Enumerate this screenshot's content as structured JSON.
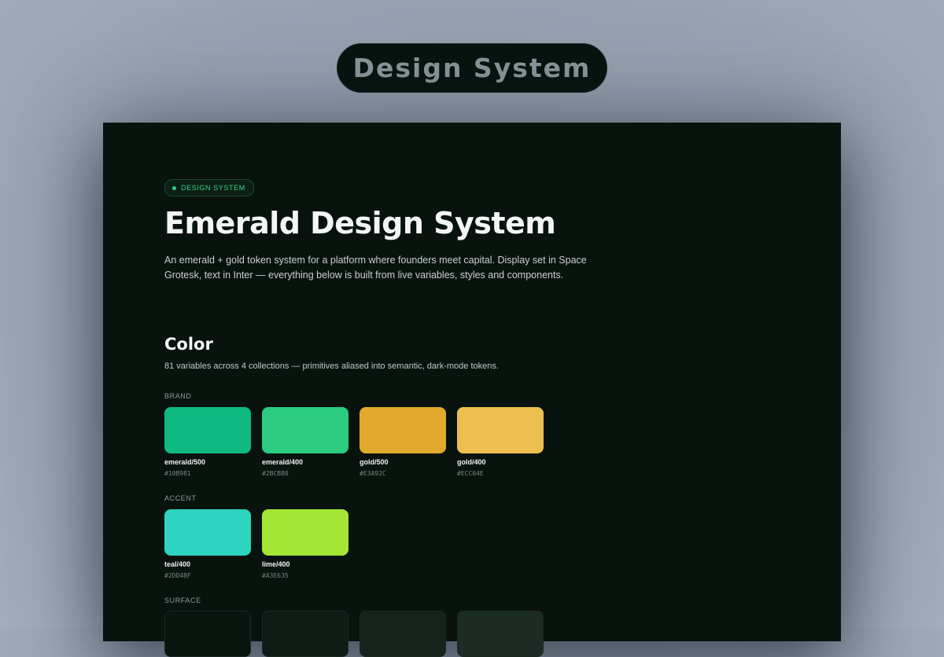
{
  "header": {
    "pill_label": "Design System"
  },
  "doc": {
    "badge": "DESIGN SYSTEM",
    "title": "Emerald Design System",
    "lead": "An emerald + gold token system for a platform where founders meet capital. Display set in Space Grotesk, text in Inter — everything below is built from live variables, styles and components."
  },
  "color_section": {
    "heading": "Color",
    "subtitle": "81 variables across 4 collections — primitives aliased into semantic, dark-mode tokens.",
    "groups": {
      "brand": {
        "label": "BRAND",
        "swatches": [
          {
            "name": "emerald/500",
            "hex": "#10B981",
            "color": "#10B981"
          },
          {
            "name": "emerald/400",
            "hex": "#2BCB80",
            "color": "#2BCB80"
          },
          {
            "name": "gold/500",
            "hex": "#E3A92C",
            "color": "#E3A92C"
          },
          {
            "name": "gold/400",
            "hex": "#ECC04E",
            "color": "#ECC04E"
          }
        ]
      },
      "accent": {
        "label": "ACCENT",
        "swatches": [
          {
            "name": "teal/400",
            "hex": "#2DD4BF",
            "color": "#2DD4BF"
          },
          {
            "name": "lime/400",
            "hex": "#A3E635",
            "color": "#A3E635"
          }
        ]
      },
      "surface": {
        "label": "SURFACE",
        "swatches": [
          {
            "color": "#0A140F"
          },
          {
            "color": "#0F1C16"
          },
          {
            "color": "#14241B"
          },
          {
            "color": "#1B2C24"
          }
        ]
      }
    }
  }
}
